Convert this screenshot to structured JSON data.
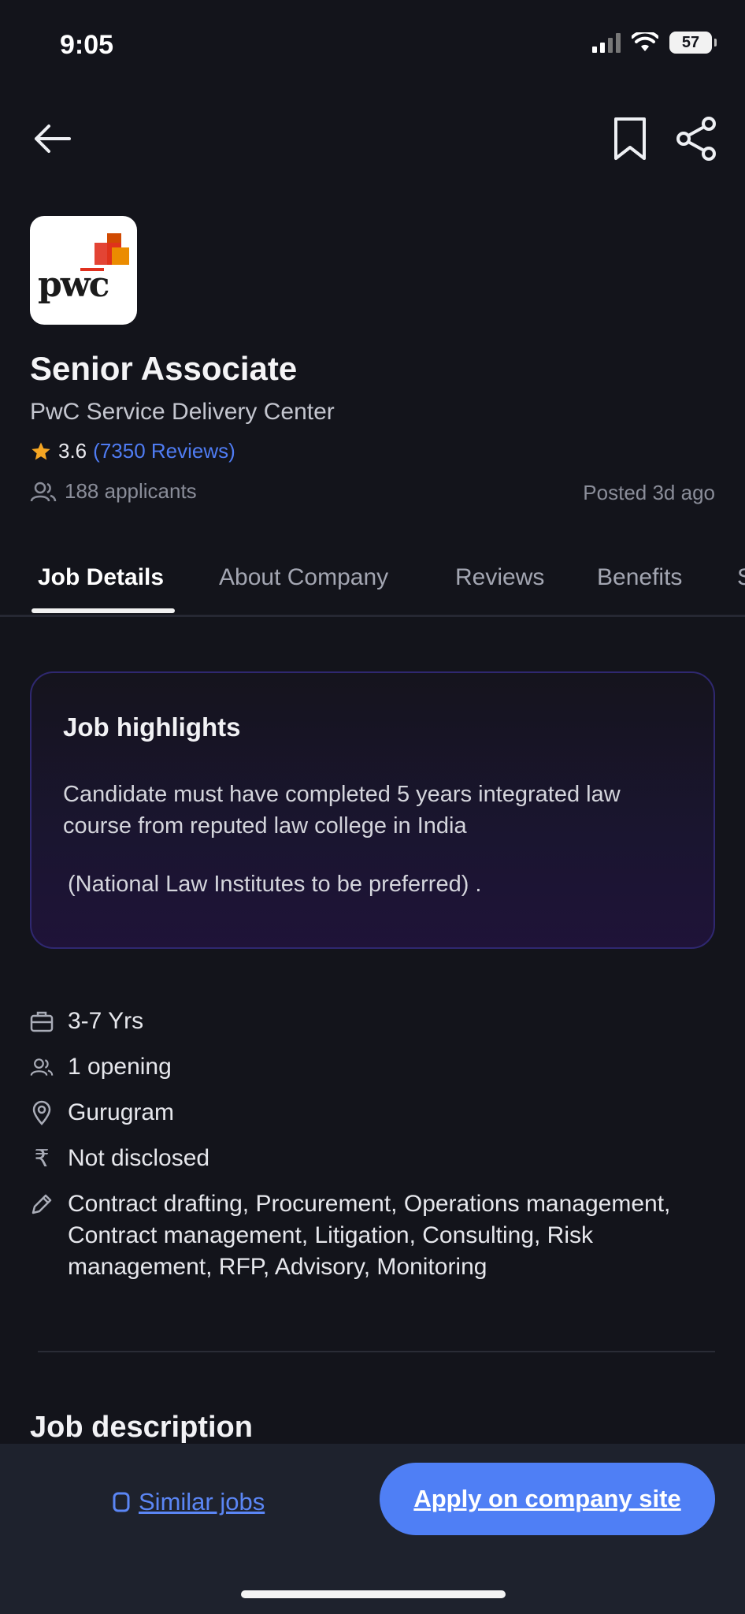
{
  "status_bar": {
    "time": "9:05",
    "battery": "57"
  },
  "job": {
    "company_logo_text": "pwc",
    "title": "Senior Associate",
    "company": "PwC Service Delivery Center",
    "rating": "3.6",
    "reviews_link": "(7350 Reviews)",
    "applicants": "188 applicants",
    "posted": "Posted 3d ago"
  },
  "tabs": [
    {
      "label": "Job Details",
      "active": true
    },
    {
      "label": "About Company",
      "active": false
    },
    {
      "label": "Reviews",
      "active": false
    },
    {
      "label": "Benefits",
      "active": false
    },
    {
      "label": "S",
      "active": false
    }
  ],
  "highlights": {
    "title": "Job highlights",
    "text": "Candidate must have completed 5 years integrated law course from reputed law college in India",
    "note": "(National Law Institutes to be preferred) ."
  },
  "details": {
    "experience": "3-7 Yrs",
    "openings": "1 opening",
    "location": "Gurugram",
    "salary": "Not disclosed",
    "skills": "Contract drafting, Procurement, Operations management, Contract management, Litigation, Consulting, Risk management, RFP, Advisory, Monitoring"
  },
  "description_heading": "Job description",
  "bottom_bar": {
    "similar_jobs": "Similar jobs",
    "apply": "Apply on company site"
  },
  "colors": {
    "background": "#13141b",
    "accent": "#4f7ff5",
    "rating_star": "#f5a623",
    "logo_orange": "#e0301e"
  },
  "icons": {
    "back": "arrow-left-icon",
    "bookmark": "bookmark-icon",
    "share": "share-icon",
    "star": "star-icon",
    "applicants": "people-icon",
    "experience": "briefcase-icon",
    "openings": "people-icon",
    "location": "map-pin-icon",
    "salary": "rupee-icon",
    "skills": "pencil-icon",
    "similar": "copy-icon"
  }
}
